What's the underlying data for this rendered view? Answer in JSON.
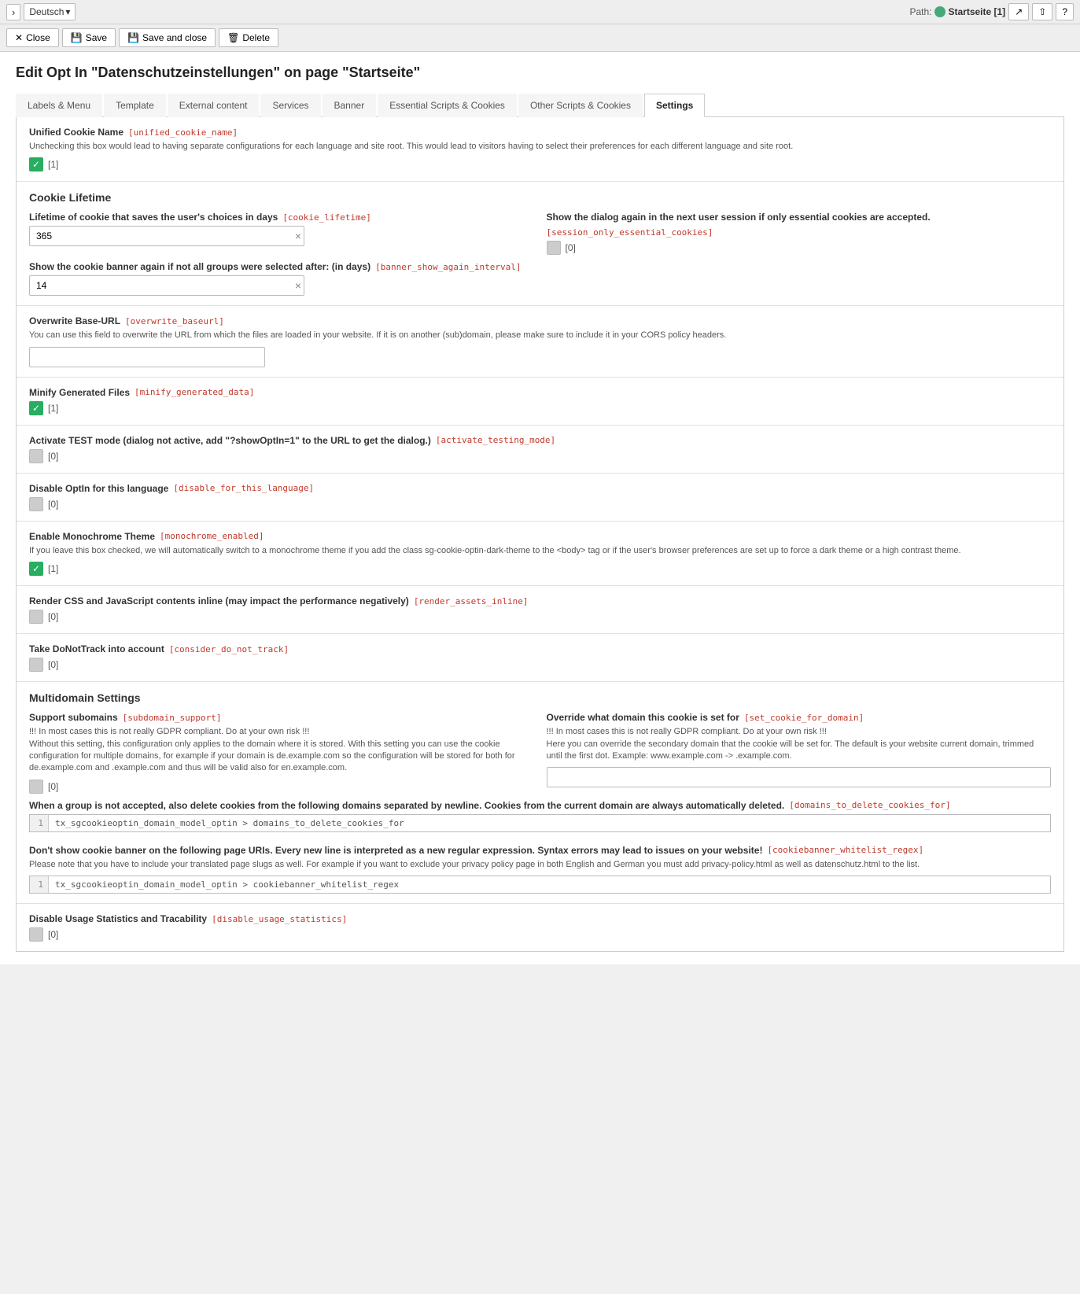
{
  "topbar": {
    "language": "Deutsch",
    "path_label": "Path:",
    "page_name": "Startseite [1]",
    "icon_external": "↗",
    "icon_share": "⇧",
    "icon_help": "?"
  },
  "actionbar": {
    "close_label": "Close",
    "save_label": "Save",
    "save_close_label": "Save and close",
    "delete_label": "Delete"
  },
  "page_title": "Edit Opt In \"Datenschutzeinstellungen\" on page \"Startseite\"",
  "tabs": [
    {
      "id": "labels",
      "label": "Labels & Menu"
    },
    {
      "id": "template",
      "label": "Template"
    },
    {
      "id": "external",
      "label": "External content"
    },
    {
      "id": "services",
      "label": "Services"
    },
    {
      "id": "banner",
      "label": "Banner"
    },
    {
      "id": "essential",
      "label": "Essential Scripts & Cookies"
    },
    {
      "id": "other",
      "label": "Other Scripts & Cookies"
    },
    {
      "id": "settings",
      "label": "Settings",
      "active": true
    }
  ],
  "settings": {
    "unified_cookie": {
      "label": "Unified Cookie Name",
      "key": "[unified_cookie_name]",
      "desc": "Unchecking this box would lead to having separate configurations for each language and site root. This would lead to visitors having to select their preferences for each different language and site root.",
      "checked": true,
      "value_label": "[1]"
    },
    "cookie_lifetime_section": {
      "title": "Cookie Lifetime",
      "lifetime": {
        "label": "Lifetime of cookie that saves the user's choices in days",
        "key": "[cookie_lifetime]",
        "value": "365"
      },
      "session_only": {
        "label": "Show the dialog again in the next user session if only essential cookies are accepted.",
        "key": "[session_only_essential_cookies]",
        "checked": false,
        "value_label": "[0]"
      },
      "show_again": {
        "label": "Show the cookie banner again if not all groups were selected after: (in days)",
        "key": "[banner_show_again_interval]",
        "value": "14"
      }
    },
    "overwrite_baseurl": {
      "label": "Overwrite Base-URL",
      "key": "[overwrite_baseurl]",
      "desc": "You can use this field to overwrite the URL from which the files are loaded in your website. If it is on another (sub)domain, please make sure to include it in your CORS policy headers.",
      "value": ""
    },
    "minify": {
      "label": "Minify Generated Files",
      "key": "[minify_generated_data]",
      "checked": true,
      "value_label": "[1]"
    },
    "test_mode": {
      "label": "Activate TEST mode (dialog not active, add \"?showOptIn=1\" to the URL to get the dialog.)",
      "key": "[activate_testing_mode]",
      "checked": false,
      "value_label": "[0]"
    },
    "disable_language": {
      "label": "Disable OptIn for this language",
      "key": "[disable_for_this_language]",
      "checked": false,
      "value_label": "[0]"
    },
    "monochrome": {
      "label": "Enable Monochrome Theme",
      "key": "[monochrome_enabled]",
      "desc": "If you leave this box checked, we will automatically switch to a monochrome theme if you add the class sg-cookie-optin-dark-theme to the <body> tag or if the user's browser preferences are set up to force a dark theme or a high contrast theme.",
      "checked": true,
      "value_label": "[1]"
    },
    "render_inline": {
      "label": "Render CSS and JavaScript contents inline (may impact the performance negatively)",
      "key": "[render_assets_inline]",
      "checked": false,
      "value_label": "[0]"
    },
    "dnt": {
      "label": "Take DoNotTrack into account",
      "key": "[consider_do_not_track]",
      "checked": false,
      "value_label": "[0]"
    },
    "multidomain": {
      "title": "Multidomain Settings",
      "subdomain_support": {
        "label": "Support subomains",
        "key": "[subdomain_support]",
        "warning": "!!! In most cases this is not really GDPR compliant. Do at your own risk !!!\nWithout this setting, this configuration only applies to the domain where it is stored. With this setting you can use the cookie configuration for multiple domains, for example if your domain is de.example.com so the configuration will be stored for both for de.example.com and .example.com and thus will be valid also for en.example.com.",
        "checked": false,
        "value_label": "[0]"
      },
      "set_cookie_for_domain": {
        "label": "Override what domain this cookie is set for",
        "key": "[set_cookie_for_domain]",
        "warning": "!!! In most cases this is not really GDPR compliant. Do at your own risk !!!\nHere you can override the secondary domain that the cookie will be set for. The default is your website current domain, trimmed until the first dot. Example: www.example.com -> .example.com.",
        "value": ""
      },
      "domains_to_delete": {
        "label": "When a group is not accepted, also delete cookies from the following domains separated by newline. Cookies from the current domain are always automatically deleted.",
        "key": "[domains_to_delete_cookies_for]",
        "line_num": "1",
        "code_value": "tx_sgcookieoptin_domain_model_optin > domains_to_delete_cookies_for"
      },
      "whitelist_regex": {
        "label": "Don't show cookie banner on the following page URIs. Every new line is interpreted as a new regular expression. Syntax errors may lead to issues on your website!",
        "key": "[cookiebanner_whitelist_regex]",
        "desc": "Please note that you have to include your translated page slugs as well. For example if you want to exclude your privacy policy page in both English and German you must add privacy-policy.html as well as datenschutz.html to the list.",
        "line_num": "1",
        "code_value": "tx_sgcookieoptin_domain_model_optin > cookiebanner_whitelist_regex"
      }
    },
    "disable_usage": {
      "label": "Disable Usage Statistics and Tracability",
      "key": "[disable_usage_statistics]",
      "checked": false,
      "value_label": "[0]"
    }
  }
}
